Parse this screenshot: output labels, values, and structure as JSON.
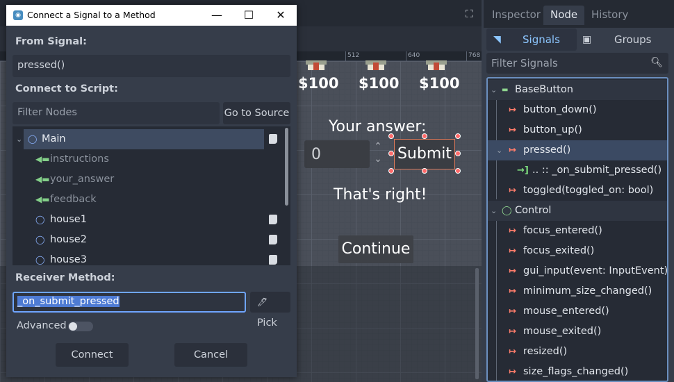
{
  "viewport": {
    "ruler_marks": [
      "512",
      "640",
      "768"
    ],
    "prices": [
      "$100",
      "$100",
      "$100"
    ],
    "your_answer_label": "Your answer:",
    "answer_value": "0",
    "submit_label": "Submit",
    "feedback_text": "That's right!",
    "continue_label": "Continue"
  },
  "dock": {
    "tabs": [
      "Inspector",
      "Node",
      "History"
    ],
    "active_tab": "Node",
    "signals_toggle": "Signals",
    "groups_toggle": "Groups",
    "filter_placeholder": "Filter Signals",
    "tree": {
      "basebutton_section": "BaseButton",
      "button_down": "button_down()",
      "button_up": "button_up()",
      "pressed": "pressed()",
      "pressed_connection": ".. :: _on_submit_pressed()",
      "toggled": "toggled(toggled_on: bool)",
      "control_section": "Control",
      "focus_entered": "focus_entered()",
      "focus_exited": "focus_exited()",
      "gui_input": "gui_input(event: InputEvent)",
      "minimum_size_changed": "minimum_size_changed()",
      "mouse_entered": "mouse_entered()",
      "mouse_exited": "mouse_exited()",
      "resized": "resized()",
      "size_flags_changed": "size_flags_changed()"
    }
  },
  "dialog": {
    "title": "Connect a Signal to a Method",
    "from_signal_label": "From Signal:",
    "from_signal_value": "pressed()",
    "connect_to_script_label": "Connect to Script:",
    "filter_nodes_placeholder": "Filter Nodes",
    "go_to_source": "Go to Source",
    "nodes": {
      "main": "Main",
      "instructions": "instructions",
      "your_answer": "your_answer",
      "feedback": "feedback",
      "house1": "house1",
      "house2": "house2",
      "house3": "house3"
    },
    "receiver_method_label": "Receiver Method:",
    "receiver_method_value": "_on_submit_pressed",
    "pick_label": "Pick",
    "advanced_label": "Advanced",
    "advanced_enabled": false,
    "connect_label": "Connect",
    "cancel_label": "Cancel"
  },
  "colors": {
    "accent": "#6fa5ff",
    "signal_icon": "#ff7d6b",
    "selection": "#3b4a63"
  }
}
